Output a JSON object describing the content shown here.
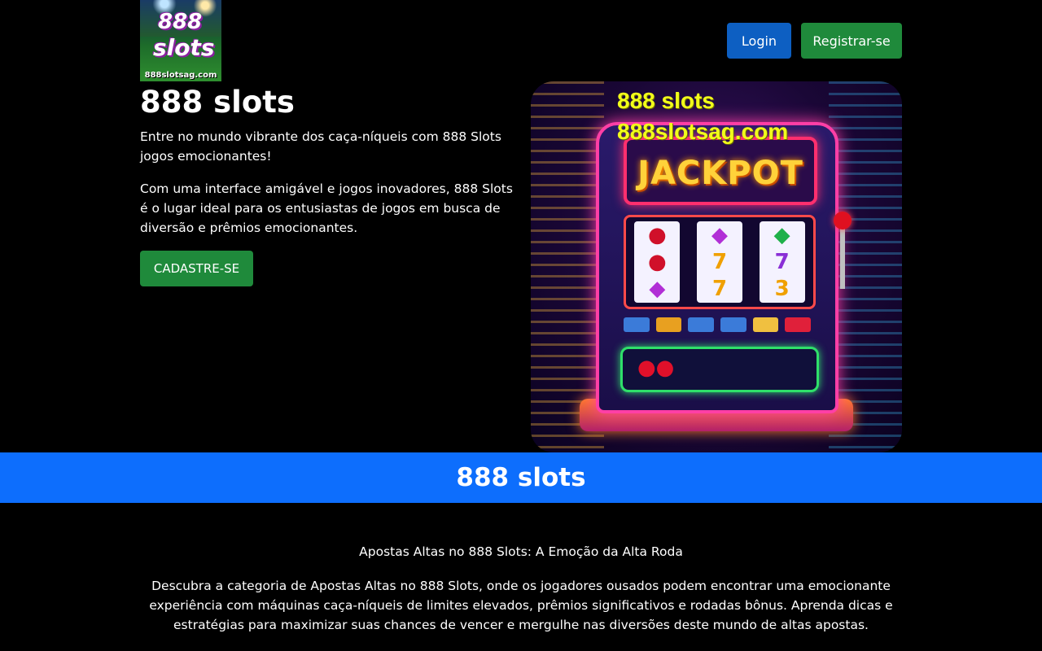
{
  "header": {
    "logo": {
      "line1": "888",
      "line2": "slots",
      "url_text": "888slotsag.com"
    },
    "login_label": "Login",
    "register_label": "Registrar-se"
  },
  "hero": {
    "title": "888 slots",
    "intro": "Entre no mundo vibrante dos caça-níqueis com 888 Slots jogos emocionantes!",
    "body": "Com uma interface amigável e jogos inovadores, 888 Slots é o lugar ideal para os entusiastas de jogos em busca de diversão e prêmios emocionantes.",
    "cta_label": "CADASTRE-SE",
    "image": {
      "watermark_line1": "888 slots",
      "watermark_line2": "888slotsag.com",
      "marquee_text": "JACKPOT"
    }
  },
  "banner": {
    "title": "888 slots"
  },
  "article": {
    "heading": "Apostas Altas no 888 Slots: A Emoção da Alta Roda",
    "paragraph": "Descubra a categoria de Apostas Altas no 888 Slots, onde os jogadores ousados podem encontrar uma emocionante experiência com máquinas caça-níqueis de limites elevados, prêmios significativos e rodadas bônus. Aprenda dicas e estratégias para maximizar suas chances de vencer e mergulhe nas diversões deste mundo de altas apostas."
  },
  "colors": {
    "background": "#000000",
    "login_button": "#0d5fc2",
    "register_button": "#1f8a3b",
    "banner": "#0d6efd"
  }
}
